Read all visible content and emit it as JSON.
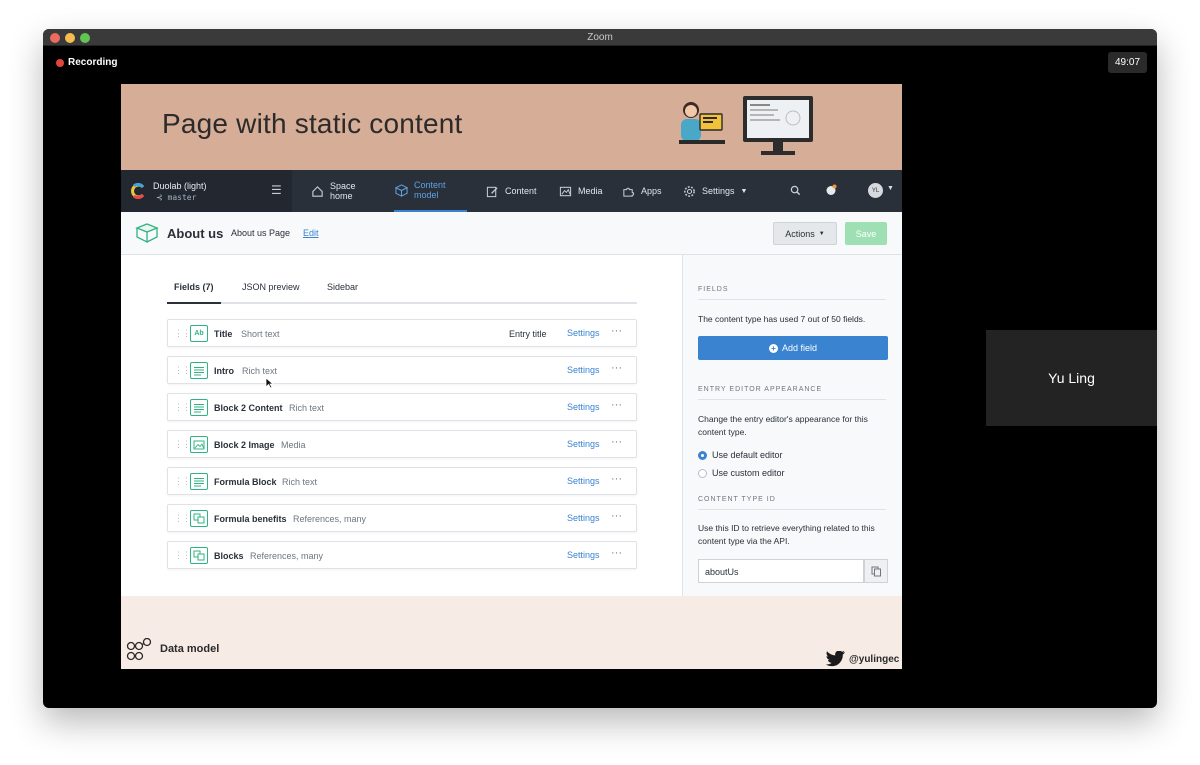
{
  "window": {
    "title": "Zoom",
    "recording_label": "Recording",
    "timer": "49:07",
    "participant_name": "Yu Ling"
  },
  "slide": {
    "title": "Page with static content",
    "footer_label": "Data model",
    "twitter_handle": "@yulingec"
  },
  "app_nav": {
    "space_name": "Duolab (light)",
    "branch": "master",
    "items": [
      {
        "label_1": "Space",
        "label_2": "home",
        "icon": "home-icon"
      },
      {
        "label_1": "Content",
        "label_2": "model",
        "icon": "content-model-icon"
      },
      {
        "label": "Content",
        "icon": "edit-icon"
      },
      {
        "label": "Media",
        "icon": "media-icon"
      },
      {
        "label": "Apps",
        "icon": "puzzle-icon"
      },
      {
        "label": "Settings",
        "icon": "gear-icon"
      }
    ],
    "avatar_initials": "YL"
  },
  "entity": {
    "title": "About us",
    "type_name": "About us Page",
    "edit_link": "Edit",
    "actions_label": "Actions",
    "save_label": "Save"
  },
  "tabs": [
    "Fields (7)",
    "JSON preview",
    "Sidebar"
  ],
  "fields": [
    {
      "name": "Title",
      "type": "Short text",
      "entry_title": "Entry title",
      "settings": "Settings",
      "icon": "text-icon"
    },
    {
      "name": "Intro",
      "type": "Rich text",
      "settings": "Settings",
      "icon": "richtext-icon"
    },
    {
      "name": "Block 2 Content",
      "type": "Rich text",
      "settings": "Settings",
      "icon": "richtext-icon"
    },
    {
      "name": "Block 2 Image",
      "type": "Media",
      "settings": "Settings",
      "icon": "media-field-icon"
    },
    {
      "name": "Formula Block",
      "type": "Rich text",
      "settings": "Settings",
      "icon": "richtext-icon"
    },
    {
      "name": "Formula benefits",
      "type": "References, many",
      "settings": "Settings",
      "icon": "reference-icon"
    },
    {
      "name": "Blocks",
      "type": "References, many",
      "settings": "Settings",
      "icon": "reference-icon"
    }
  ],
  "sidebar": {
    "fields_heading": "FIELDS",
    "fields_text": "The content type has used 7 out of 50 fields.",
    "add_field": "Add field",
    "editor_heading": "ENTRY EDITOR APPEARANCE",
    "editor_text": "Change the entry editor's appearance for this content type.",
    "option_default": "Use default editor",
    "option_custom": "Use custom editor",
    "id_heading": "CONTENT TYPE ID",
    "id_text": "Use this ID to retrieve everything related to this content type via the API.",
    "id_value": "aboutUs"
  },
  "colors": {
    "accent": "#3a83d1",
    "nav_bg": "#2a3039",
    "banner": "#d6ad97",
    "field_icon": "#2fb383"
  }
}
